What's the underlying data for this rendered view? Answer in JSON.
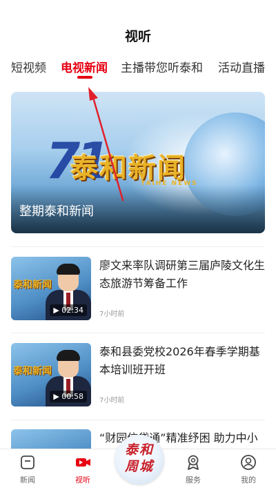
{
  "header": {
    "title": "视听"
  },
  "tabs": [
    {
      "label": "短视频",
      "active": false
    },
    {
      "label": "电视新闻",
      "active": true
    },
    {
      "label": "主播带您听泰和",
      "active": false
    },
    {
      "label": "活动直播",
      "active": false
    }
  ],
  "hero": {
    "logo_text": "泰和新闻",
    "logo_subtext": "TAIHE NEWS",
    "caption": "整期泰和新闻"
  },
  "news": [
    {
      "title": "廖文来率队调研第三届庐陵文化生态旅游节筹备工作",
      "duration": "02:34",
      "time": "7小时前",
      "thumb_logo": "泰和新闻"
    },
    {
      "title": "泰和县委党校2026年春季学期基本培训班开班",
      "duration": "00:58",
      "time": "7小时前",
      "thumb_logo": "泰和新闻"
    },
    {
      "title": "“财园信贷通”精准纾困 助力中小企业焕发新活力",
      "duration": "",
      "time": "",
      "thumb_logo": ""
    }
  ],
  "bottom_nav": [
    {
      "label": "新闻",
      "icon": "news-icon",
      "active": false
    },
    {
      "label": "视听",
      "icon": "video-icon",
      "active": true
    },
    {
      "label": "",
      "icon": "center-badge",
      "active": false
    },
    {
      "label": "服务",
      "icon": "service-icon",
      "active": false
    },
    {
      "label": "我的",
      "icon": "user-icon",
      "active": false
    }
  ],
  "center_badge": {
    "line1": "泰和",
    "line2": "周城"
  },
  "colors": {
    "accent": "#e60012",
    "annotation": "#e0202a"
  }
}
